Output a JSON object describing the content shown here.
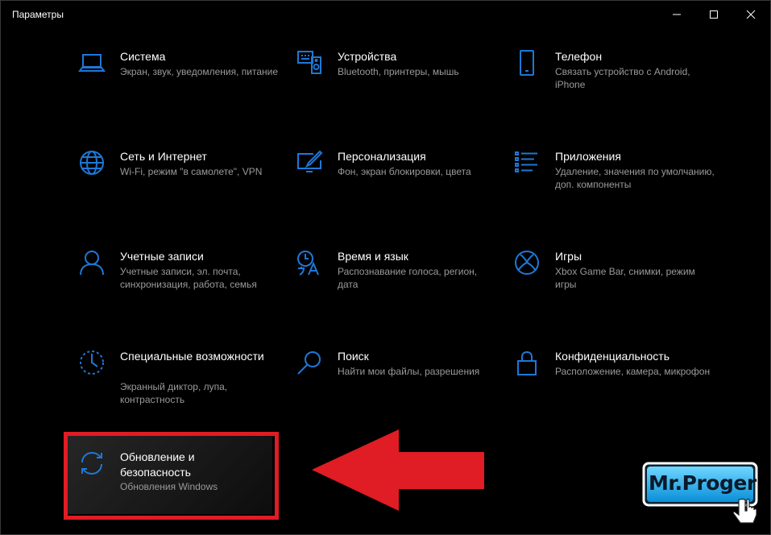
{
  "window": {
    "title": "Параметры"
  },
  "tiles": [
    {
      "name": "Система",
      "desc": "Экран, звук, уведомления, питание"
    },
    {
      "name": "Устройства",
      "desc": "Bluetooth, принтеры, мышь"
    },
    {
      "name": "Телефон",
      "desc": "Связать устройство с Android, iPhone"
    },
    {
      "name": "Сеть и Интернет",
      "desc": "Wi-Fi, режим \"в самолете\", VPN"
    },
    {
      "name": "Персонализация",
      "desc": "Фон, экран блокировки, цвета"
    },
    {
      "name": "Приложения",
      "desc": "Удаление, значения по умолчанию, доп. компоненты"
    },
    {
      "name": "Учетные записи",
      "desc": "Учетные записи, эл. почта, синхронизация, работа, семья"
    },
    {
      "name": "Время и язык",
      "desc": "Распознавание голоса, регион, дата"
    },
    {
      "name": "Игры",
      "desc": "Xbox Game Bar, снимки, режим игры"
    },
    {
      "name": "Специальные возможности",
      "desc": "Экранный диктор, лупа, контрастность"
    },
    {
      "name": "Поиск",
      "desc": "Найти мои файлы, разрешения"
    },
    {
      "name": "Конфиденциальность",
      "desc": "Расположение, камера, микрофон"
    },
    {
      "name": "Обновление и безопасность",
      "desc": "Обновления Windows"
    }
  ],
  "logo": {
    "text": "Mr.Proger"
  },
  "colors": {
    "accent": "#1e78d7",
    "highlight": "#e01c24",
    "arrow": "#e01c24"
  }
}
